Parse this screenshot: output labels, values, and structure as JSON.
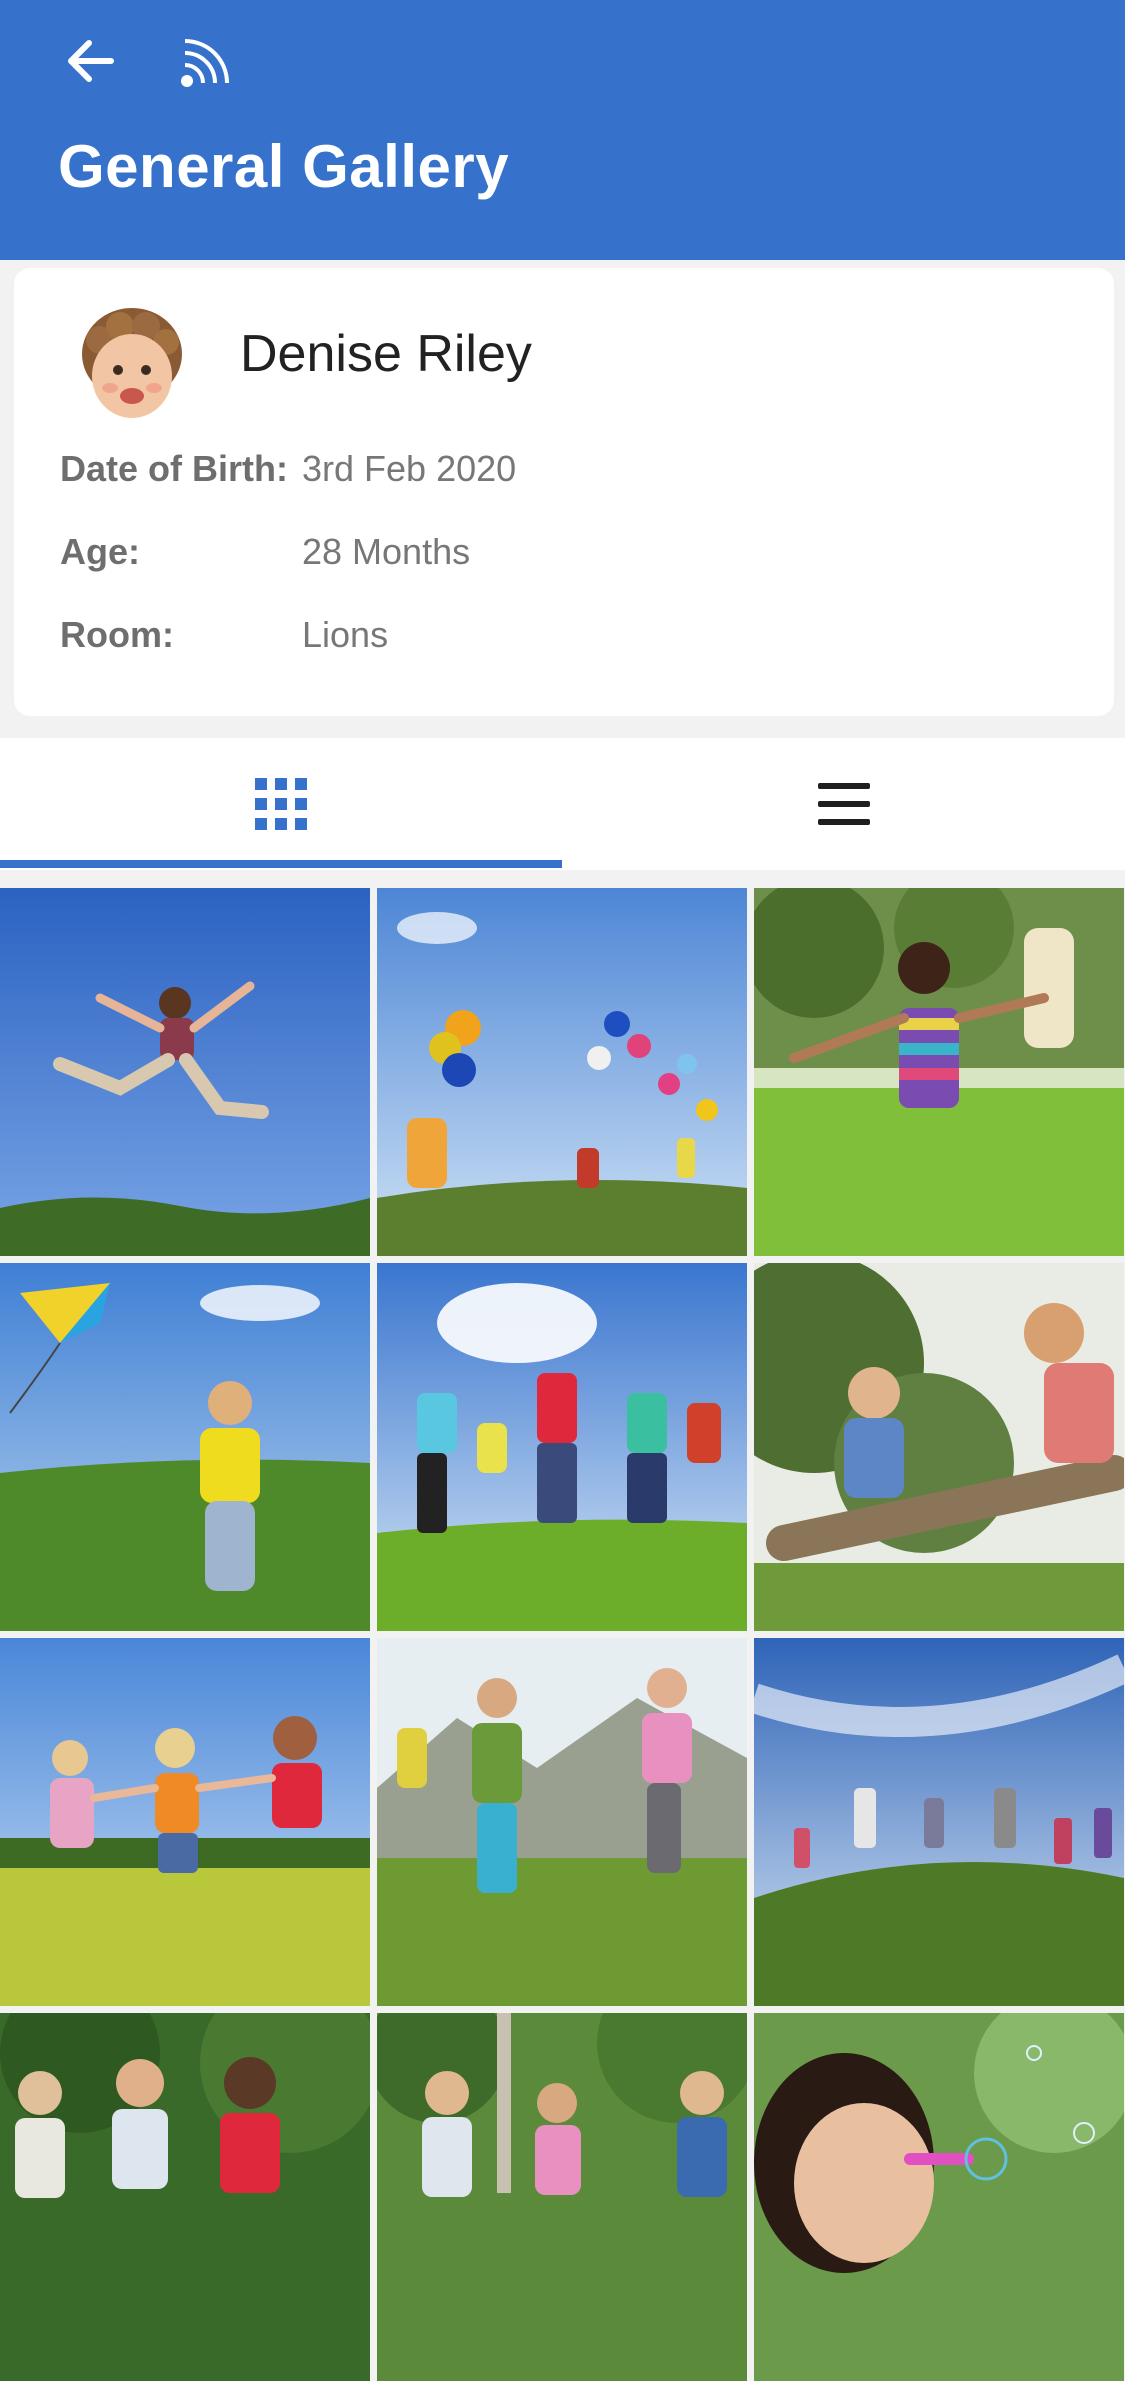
{
  "header": {
    "title": "General Gallery",
    "back_icon": "arrow-left-icon",
    "feed_icon": "rss-feed-icon",
    "background": "#3672cc"
  },
  "child": {
    "name": "Denise Riley",
    "avatar_icon": "child-avatar",
    "fields": [
      {
        "label": "Date of Birth:",
        "value": "3rd Feb 2020"
      },
      {
        "label": "Age:",
        "value": "28 Months"
      },
      {
        "label": "Room:",
        "value": "Lions"
      }
    ]
  },
  "tabs": [
    {
      "name": "grid-view",
      "icon": "grid-icon",
      "active": true
    },
    {
      "name": "list-view",
      "icon": "list-icon",
      "active": false
    }
  ],
  "accent_color": "#3672cc",
  "gallery": {
    "photos": [
      {
        "subject": "boy-jumping-sky"
      },
      {
        "subject": "children-balloons"
      },
      {
        "subject": "girl-running-park"
      },
      {
        "subject": "boy-kite-field"
      },
      {
        "subject": "kids-jumping-group"
      },
      {
        "subject": "boys-climbing-log"
      },
      {
        "subject": "girls-holding-hands"
      },
      {
        "subject": "kids-running-hills"
      },
      {
        "subject": "kids-circle-hill"
      },
      {
        "subject": "children-running-forest"
      },
      {
        "subject": "kids-walking-park"
      },
      {
        "subject": "girl-blowing-bubbles"
      }
    ]
  }
}
